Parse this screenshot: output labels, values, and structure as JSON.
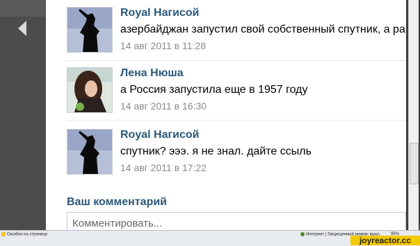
{
  "comments": [
    {
      "author": "Royal Нагисой",
      "text": "азербайджан запустил свой собственный спутник, а рашка ?",
      "date": "14 авг 2011 в 11:28"
    },
    {
      "author": "Лена Нюша",
      "text": "а Россия запустила еще в 1957 году",
      "date": "14 авг 2011 в 16:30"
    },
    {
      "author": "Royal Нагисой",
      "text": "спутник? эээ. я не знал. дайте ссыль",
      "date": "14 авг 2011 в 17:22"
    }
  ],
  "compose": {
    "heading": "Ваш комментарий",
    "placeholder": "Комментировать..."
  },
  "status_bar": {
    "left_text": "Ошибка на странице.",
    "mid_text": "Интернет | Защищенный режим: выкл.",
    "zoom": "95%"
  },
  "watermark": "joyreactor.cc",
  "colors": {
    "link": "#2b587a",
    "date": "#8a8a8a",
    "dark_bg": "#4c4c4c"
  }
}
